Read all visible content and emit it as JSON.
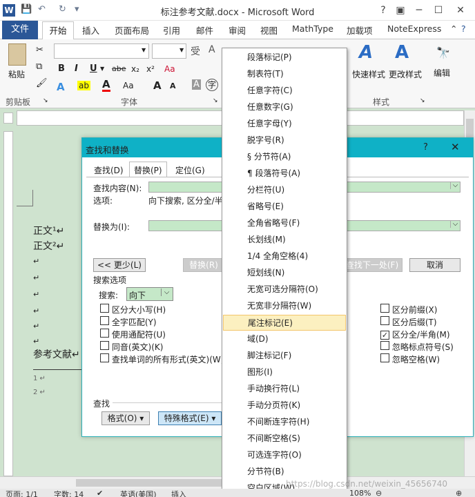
{
  "window": {
    "title": "标注参考文献.docx - Microsoft Word",
    "app_icon": "W"
  },
  "quick_access": {
    "save": "💾",
    "undo": "↶",
    "redo": "↻"
  },
  "tabs": {
    "file": "文件",
    "home": "开始",
    "items": [
      "插入",
      "页面布局",
      "引用",
      "邮件",
      "审阅",
      "视图",
      "MathType",
      "加载项",
      "NoteExpress"
    ]
  },
  "ribbon": {
    "paste": "粘贴",
    "clipboard": "剪贴板",
    "font": "字体",
    "styles": "样式",
    "quick_style": "快速样式",
    "change_style": "更改样式",
    "edit": "编辑",
    "bold": "B",
    "italic": "I",
    "underline": "U",
    "strike": "abe",
    "sub": "x₂",
    "sup": "x²",
    "grow": "A",
    "phonetic": "字",
    "clearfmt": "Aa",
    "style_glyph": "A"
  },
  "document": {
    "lines": [
      "正文¹↵",
      "正文²↵",
      "↵",
      "↵",
      "↵",
      "↵",
      "↵",
      "↵",
      "参考文献↵"
    ],
    "footnotes": [
      "1 ↵",
      "2 ↵"
    ]
  },
  "dialog": {
    "title": "查找和替换",
    "tabs": [
      "查找(D)",
      "替换(P)",
      "定位(G)"
    ],
    "find_label": "查找内容(N):",
    "options_label": "选项:",
    "options_value": "向下搜索, 区分全/半",
    "replace_label": "替换为(I):",
    "less_button": "<< 更少(L)",
    "replace_button": "替换(R)",
    "find_next_button": "查找下一处(F)",
    "cancel_button": "取消",
    "search_options": "搜索选项",
    "search_label": "搜索:",
    "search_value": "向下",
    "left_options": [
      "区分大小写(H)",
      "全字匹配(Y)",
      "使用通配符(U)",
      "同音(英文)(K)",
      "查找单词的所有形式(英文)(W)"
    ],
    "right_options": [
      {
        "label": "区分前缀(X)",
        "checked": false
      },
      {
        "label": "区分后缀(T)",
        "checked": false
      },
      {
        "label": "区分全/半角(M)",
        "checked": true
      },
      {
        "label": "忽略标点符号(S)",
        "checked": false
      },
      {
        "label": "忽略空格(W)",
        "checked": false
      }
    ],
    "find_section": "查找",
    "format_button": "格式(O) ▾",
    "special_button": "特殊格式(E) ▾"
  },
  "menu": {
    "items": [
      "段落标记(P)",
      "制表符(T)",
      "任意字符(C)",
      "任意数字(G)",
      "任意字母(Y)",
      "脱字号(R)",
      "§ 分节符(A)",
      "¶ 段落符号(A)",
      "分栏符(U)",
      "省略号(E)",
      "全角省略号(F)",
      "长划线(M)",
      "1/4 全角空格(4)",
      "短划线(N)",
      "无宽可选分隔符(O)",
      "无宽非分隔符(W)",
      "尾注标记(E)",
      "域(D)",
      "脚注标记(F)",
      "图形(I)",
      "手动换行符(L)",
      "手动分页符(K)",
      "不间断连字符(H)",
      "不间断空格(S)",
      "可选连字符(O)",
      "分节符(B)",
      "空白区域(W)"
    ],
    "highlighted_index": 16
  },
  "status": {
    "page": "页面: 1/1",
    "words": "字数: 14",
    "lang": "英语(美国)",
    "insert": "插入",
    "zoom": "108%"
  },
  "watermark": "https://blog.csdn.net/weixin_45656740"
}
